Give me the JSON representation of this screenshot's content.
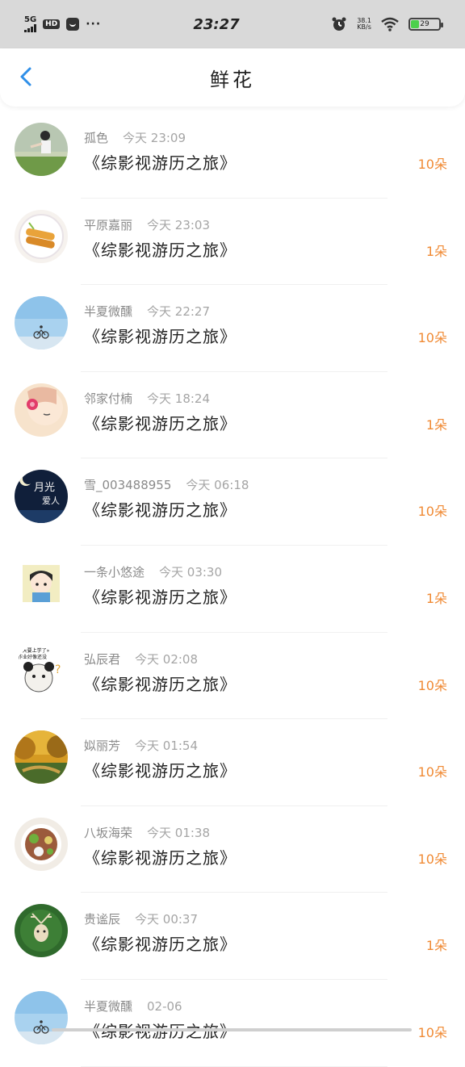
{
  "status_bar": {
    "network": "5G",
    "hd": "HD",
    "more": "···",
    "time": "23:27",
    "speed_value": "38.1",
    "speed_unit": "KB/s",
    "battery": "29",
    "battery_level": 0.29
  },
  "header": {
    "title": "鲜花"
  },
  "colors": {
    "accent": "#2f8fe8",
    "count": "#f08a34"
  },
  "items": [
    {
      "avatar": "avatar-person-field",
      "name": "孤色",
      "time": "今天 23:09",
      "book": "《综影视游历之旅》",
      "count": "10朵"
    },
    {
      "avatar": "avatar-food-plate",
      "name": "平原嘉丽",
      "time": "今天 23:03",
      "book": "《综影视游历之旅》",
      "count": "1朵"
    },
    {
      "avatar": "avatar-sky-bicycle",
      "name": "半夏微醺",
      "time": "今天 22:27",
      "book": "《综影视游历之旅》",
      "count": "10朵"
    },
    {
      "avatar": "avatar-girl-flower",
      "name": "邻家付楠",
      "time": "今天 18:24",
      "book": "《综影视游历之旅》",
      "count": "1朵"
    },
    {
      "avatar": "avatar-moonlight-text",
      "name": "雪_003488955",
      "time": "今天 06:18",
      "book": "《综影视游历之旅》",
      "count": "10朵"
    },
    {
      "avatar": "avatar-cartoon-girl",
      "name": "一条小悠途",
      "time": "今天 03:30",
      "book": "《综影视游历之旅》",
      "count": "1朵"
    },
    {
      "avatar": "avatar-panda-meme",
      "name": "弘辰君",
      "time": "今天 02:08",
      "book": "《综影视游历之旅》",
      "count": "10朵"
    },
    {
      "avatar": "avatar-autumn-forest",
      "name": "姒丽芳",
      "time": "今天 01:54",
      "book": "《综影视游历之旅》",
      "count": "10朵"
    },
    {
      "avatar": "avatar-food-bowl",
      "name": "八坂海荣",
      "time": "今天 01:38",
      "book": "《综影视游历之旅》",
      "count": "10朵"
    },
    {
      "avatar": "avatar-deer-forest",
      "name": "贵谧辰",
      "time": "今天 00:37",
      "book": "《综影视游历之旅》",
      "count": "1朵"
    },
    {
      "avatar": "avatar-sky-bicycle",
      "name": "半夏微醺",
      "time": "02-06",
      "book": "《综影视游历之旅》",
      "count": "10朵"
    }
  ]
}
